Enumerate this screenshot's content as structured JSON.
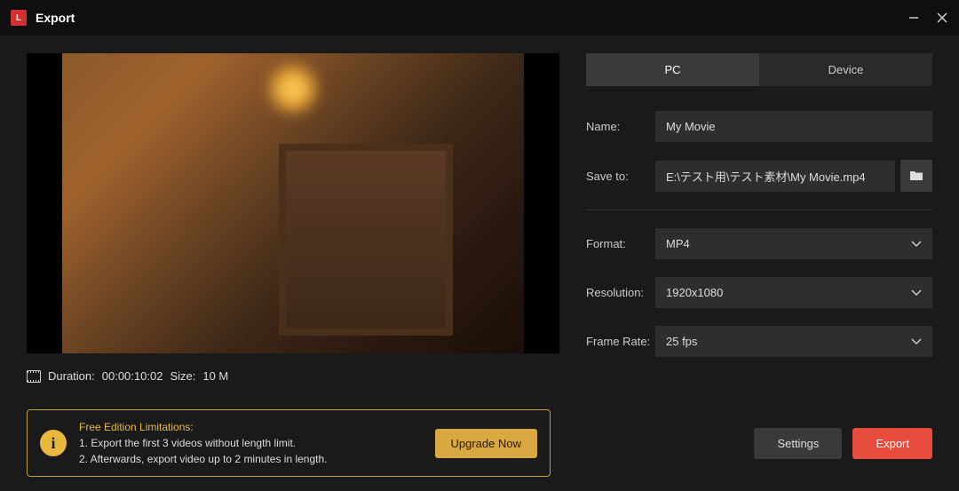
{
  "window": {
    "title": "Export"
  },
  "preview": {
    "duration_label": "Duration:",
    "duration_value": "00:00:10:02",
    "size_label": "Size:",
    "size_value": "10 M"
  },
  "tabs": {
    "pc": "PC",
    "device": "Device"
  },
  "form": {
    "name_label": "Name:",
    "name_value": "My Movie",
    "saveto_label": "Save to:",
    "saveto_value": "E:\\テスト用\\テスト素材\\My Movie.mp4",
    "format_label": "Format:",
    "format_value": "MP4",
    "resolution_label": "Resolution:",
    "resolution_value": "1920x1080",
    "framerate_label": "Frame Rate:",
    "framerate_value": "25 fps"
  },
  "limitation": {
    "title": "Free Edition Limitations:",
    "line1": "1. Export the first 3 videos without length limit.",
    "line2": "2. Afterwards, export video up to 2 minutes in length.",
    "upgrade": "Upgrade Now"
  },
  "buttons": {
    "settings": "Settings",
    "export": "Export"
  }
}
